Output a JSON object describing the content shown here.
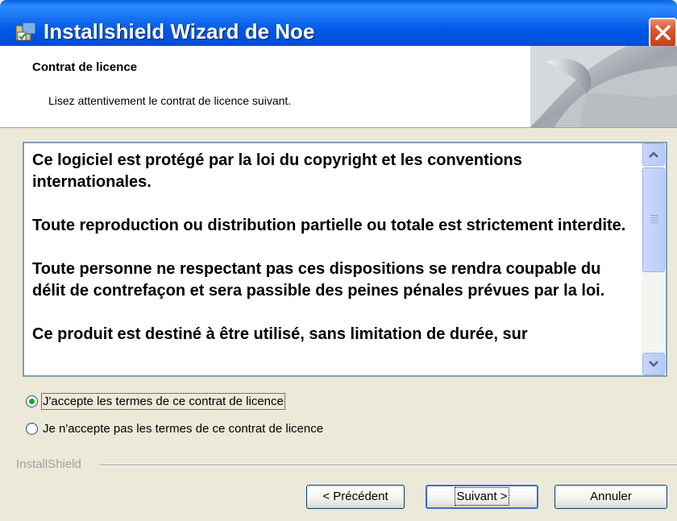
{
  "window": {
    "title": "Installshield Wizard de Noe"
  },
  "header": {
    "title": "Contrat de licence",
    "subtitle": "Lisez attentivement le contrat de licence suivant."
  },
  "license": {
    "paragraphs": [
      "Ce logiciel est protégé par la loi du copyright et les conventions internationales.",
      "Toute reproduction ou distribution partielle ou totale est strictement interdite.",
      "Toute personne ne respectant pas ces dispositions se rendra coupable du délit de contrefaçon et sera passible des peines pénales prévues par la loi.",
      "Ce produit est destiné à être utilisé, sans limitation de durée, sur"
    ]
  },
  "options": {
    "accept_label": "J'accepte les termes de ce contrat de licence",
    "decline_label": "Je n'accepte pas les termes de ce contrat de licence",
    "selected": "accept"
  },
  "brand": {
    "label": "InstallShield"
  },
  "buttons": {
    "back_label": "< Précédent",
    "next_label": "Suivant >",
    "cancel_label": "Annuler"
  },
  "icons": {
    "window": "installer-icon",
    "close": "close-icon",
    "scroll_up": "chevron-up-icon",
    "scroll_down": "chevron-down-icon"
  },
  "colors": {
    "titlebar": "#0058e6",
    "close_button": "#d9572f",
    "radio_check": "#21a121"
  }
}
